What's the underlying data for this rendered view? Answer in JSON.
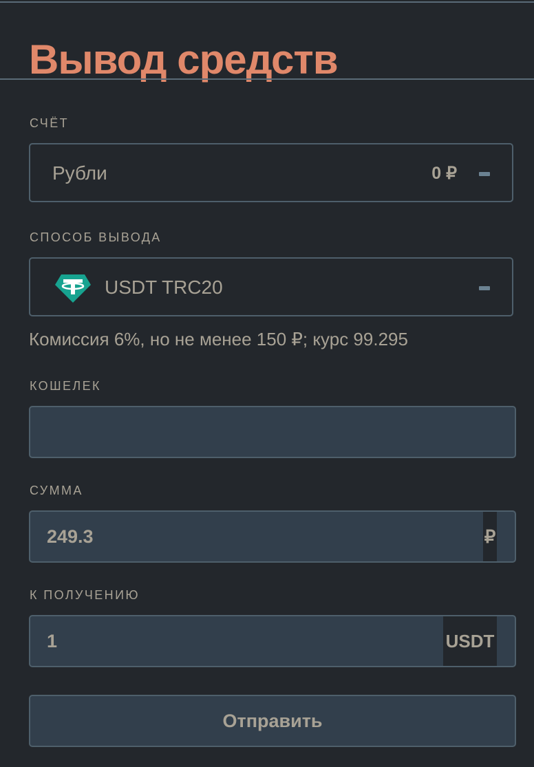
{
  "title": "Вывод средств",
  "account": {
    "label": "СЧЁТ",
    "value": "Рубли",
    "balance": "0 ₽",
    "toggle_icon": "minus-icon"
  },
  "method": {
    "label": "СПОСОБ ВЫВОДА",
    "icon": "tether-icon",
    "value": "USDT TRC20",
    "toggle_icon": "minus-icon",
    "hint": "Комиссия 6%, но не менее 150 ₽; курс 99.295"
  },
  "wallet": {
    "label": "КОШЕЛЕК",
    "value": ""
  },
  "amount": {
    "label": "СУММА",
    "value": "249.3",
    "currency": "₽"
  },
  "receive": {
    "label": "К ПОЛУЧЕНИЮ",
    "value": "1",
    "currency": "USDT"
  },
  "submit_label": "Отправить",
  "colors": {
    "background": "#23272c",
    "accent": "#e0886a",
    "text": "#a8a295",
    "field": "#323f4c",
    "border": "#4e5f6b"
  }
}
